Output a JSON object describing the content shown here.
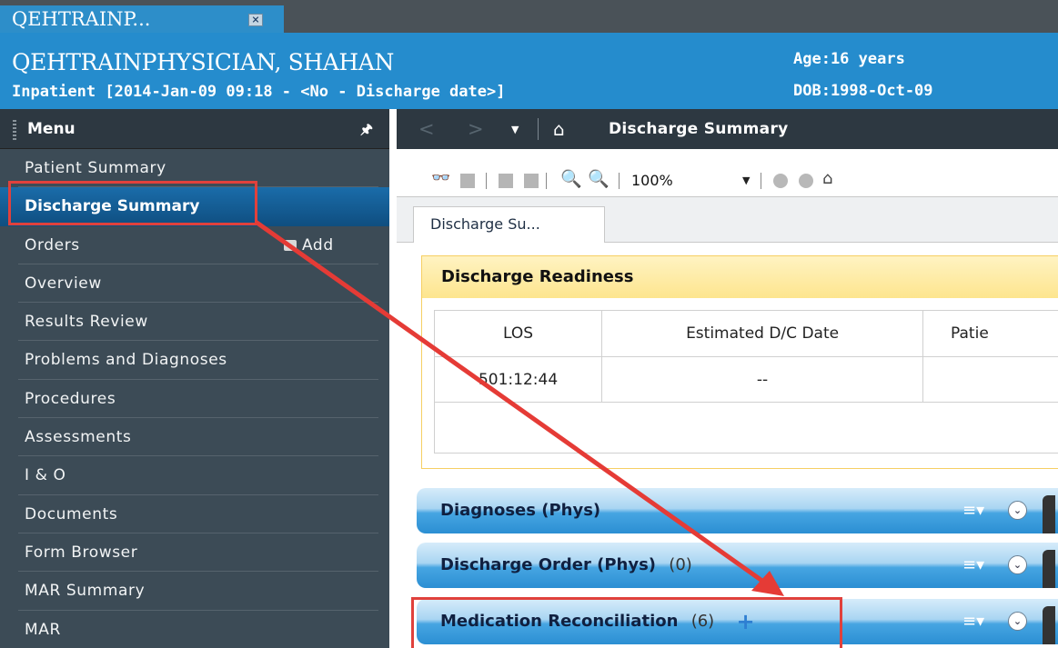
{
  "window": {
    "tab_title": "QEHTRAINP...",
    "tab_close_glyph": "×"
  },
  "banner": {
    "patient_name": "QEHTRAINPHYSICIAN, SHAHAN",
    "encounter": "Inpatient [2014-Jan-09 09:18 - <No - Discharge date>]",
    "age": "Age:16 years",
    "dob": "DOB:1998-Oct-09"
  },
  "menu": {
    "title": "Menu",
    "pin_icon": "pin-icon",
    "items": [
      {
        "label": "Patient Summary"
      },
      {
        "label": "Discharge Summary",
        "selected": true
      },
      {
        "label": "Orders",
        "action": "Add"
      },
      {
        "label": "Overview"
      },
      {
        "label": "Results Review"
      },
      {
        "label": "Problems and Diagnoses"
      },
      {
        "label": "Procedures"
      },
      {
        "label": "Assessments"
      },
      {
        "label": "I & O"
      },
      {
        "label": "Documents"
      },
      {
        "label": "Form Browser"
      },
      {
        "label": "MAR Summary"
      },
      {
        "label": "MAR"
      }
    ]
  },
  "navbar": {
    "title": "Discharge Summary",
    "icons": [
      "back-icon",
      "forward-icon",
      "dropdown-icon",
      "home-icon"
    ]
  },
  "toolbar": {
    "zoom": "100%",
    "icons": [
      "binoculars-icon",
      "page-icon",
      "prev-icon",
      "next-icon",
      "zoom-out-icon",
      "zoom-in-icon",
      "circle-icon",
      "circle-icon",
      "home-icon"
    ]
  },
  "doc_tab": {
    "label": "Discharge Su..."
  },
  "readiness": {
    "title": "Discharge Readiness",
    "columns": [
      "LOS",
      "Estimated D/C Date",
      "Patie"
    ],
    "values": [
      "501:12:44",
      "--",
      ""
    ]
  },
  "sections": [
    {
      "title": "Diagnoses (Phys)",
      "count": ""
    },
    {
      "title": "Discharge Order (Phys)",
      "count": "(0)"
    },
    {
      "title": "Medication Reconciliation",
      "count": "(6)"
    }
  ],
  "colors": {
    "banner": "#258ccd",
    "sidebar": "#3c4b56",
    "selected_item": "#155e93",
    "highlight": "#e0413c"
  }
}
